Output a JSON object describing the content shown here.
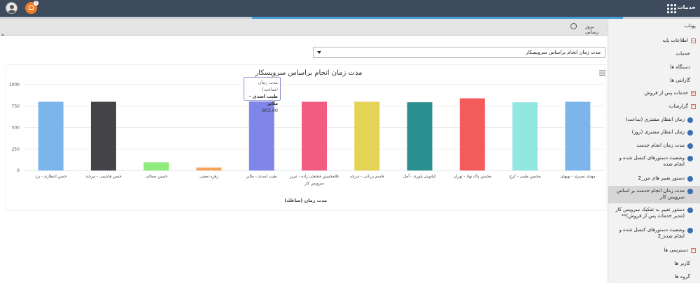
{
  "topbar": {
    "brand": "خدمات",
    "notif_count": "1"
  },
  "toolbar": {
    "refresh_label": "بروز رسانی"
  },
  "report_select": {
    "value": "مدت زمان انجام براساس سرویسکار"
  },
  "sidebar": {
    "home": "پوتاب",
    "base_info": "اطلاعات پایه",
    "services": "خدمات",
    "devices": "دستگاه ها",
    "warranties": "گارانتی ها",
    "after_sales": "خدمات پس از فروش",
    "reports": "گزارشات",
    "report_items": [
      "زمان انتظار مشتری (ساعت)",
      "زمان انتظار مشتری (روز)",
      "مدت زمان انجام خدمت",
      "وضعیت دستورهای کنسل شده و انجام شده",
      "دستور تغییر های من_2",
      "مدت زمان انجام خدمت بر اساس سرویس کار",
      "دستور تغییر به تفکیک سرویس کار (مدیر خدمات پس از فروش)**",
      "وضعیت دستورهای کنسل شده و انجام شده_2"
    ],
    "access": "دسترسی ها",
    "users": "کاربر ها",
    "groups": "گروه ها"
  },
  "chart_data": {
    "type": "bar",
    "title": "مدت زمان انجام براساس سرویسکار",
    "categories": [
      "مهدی نصیری - بهبهان",
      "محسن طیبی - کرج",
      "محسن پاک نهاد - تهران",
      "کیانوش یلوری - آمل",
      "قاسم یزدانی - دیرچه",
      "غلامحسین فتحعلی زاده - تبریز سرویس کار",
      "طیب اسدی - ملایر",
      "زهره نعمتی",
      "حسین صحابی",
      "حسن هاشمی - بیرجند",
      "حسن انتظاری - یزد"
    ],
    "values": [
      800,
      795,
      840,
      795,
      800,
      800,
      803,
      35,
      95,
      800,
      800
    ],
    "colors": [
      "#7cb5ec",
      "#91e8e1",
      "#f45b5b",
      "#2b908f",
      "#e4d354",
      "#f15c80",
      "#8085e9",
      "#f7a35c",
      "#90ed7d",
      "#434348",
      "#7cb5ec"
    ],
    "yticks": [
      0,
      250,
      500,
      750,
      1000
    ],
    "ylim": [
      0,
      1000
    ],
    "legend": "مدت زمان (ساعت)",
    "tooltip": {
      "header": "مدت زمان (ساعت)",
      "name": "طیب اسدی - ملایر",
      "value": "803.00"
    }
  }
}
